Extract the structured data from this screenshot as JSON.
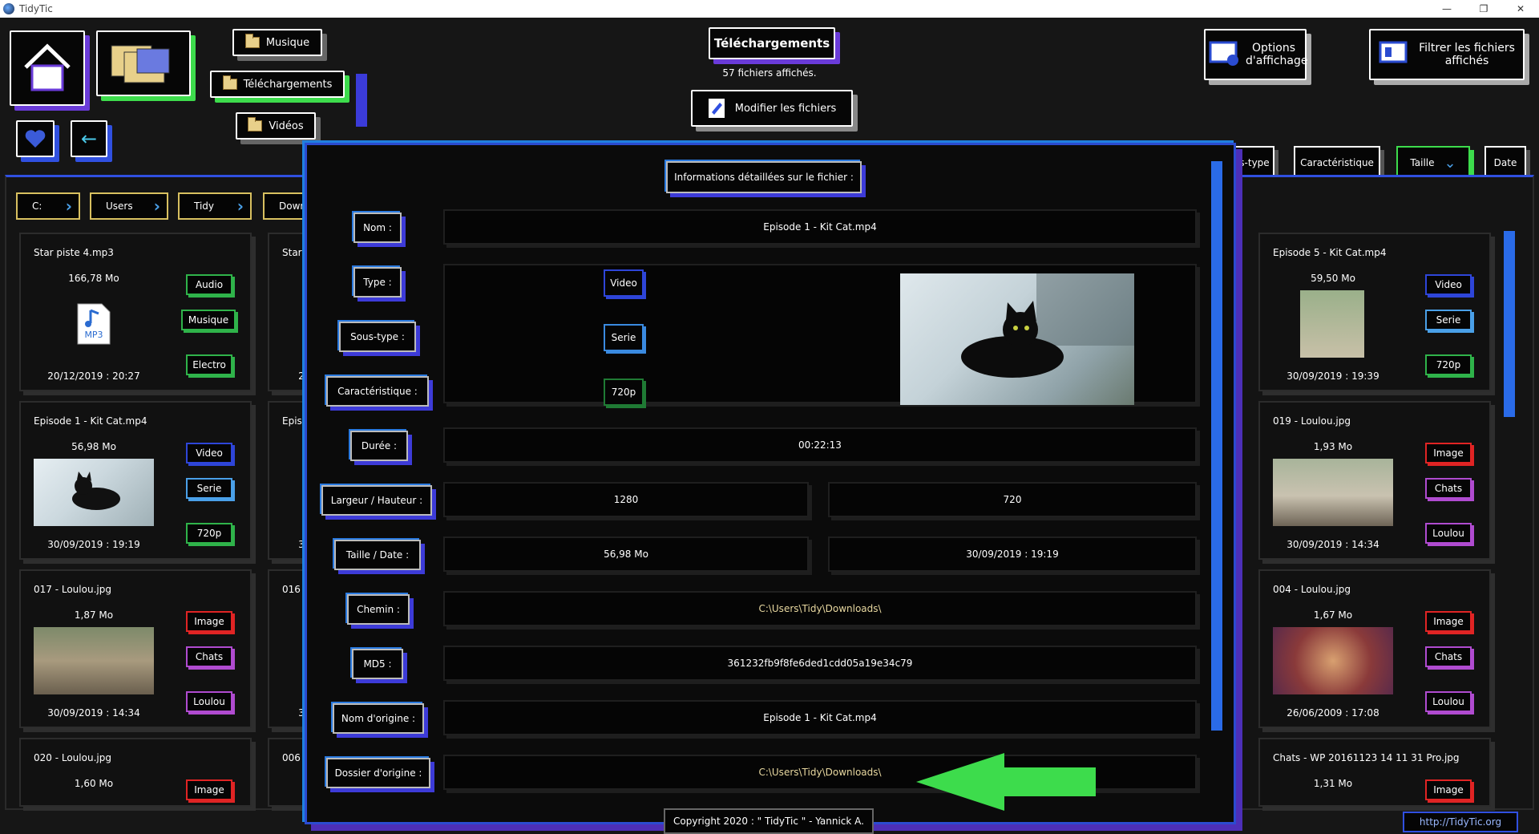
{
  "window": {
    "title": "TidyTic",
    "minimize": "—",
    "restore": "❐",
    "close": "✕"
  },
  "top": {
    "folders": [
      "Musique",
      "Téléchargements",
      "Vidéos"
    ],
    "current_folder": "Téléchargements",
    "files_count": "57 fichiers affichés.",
    "modify_btn": "Modifier les fichiers",
    "options_btn": "Options d'affichage",
    "filter_btn": "Filtrer les fichiers affichés"
  },
  "breadcrumb": [
    "C:",
    "Users",
    "Tidy",
    "Down"
  ],
  "sort": {
    "subtype": "s-type",
    "characteristic": "Caractéristique",
    "size": "Taille",
    "date": "Date"
  },
  "cards_left": [
    {
      "name": "Star piste 4.mp3",
      "size": "166,78 Mo",
      "date": "20/12/2019 : 20:27",
      "tags": [
        "Audio",
        "Musique",
        "Electro"
      ]
    },
    {
      "name": "Episode 1 - Kit Cat.mp4",
      "size": "56,98 Mo",
      "date": "30/09/2019 : 19:19",
      "tags": [
        "Video",
        "Serie",
        "720p"
      ]
    },
    {
      "name": "017 - Loulou.jpg",
      "size": "1,87 Mo",
      "date": "30/09/2019 : 14:34",
      "tags": [
        "Image",
        "Chats",
        "Loulou"
      ]
    },
    {
      "name": "020 - Loulou.jpg",
      "size": "1,60 Mo",
      "date": "",
      "tags": [
        "Image"
      ]
    }
  ],
  "cards_mid": [
    {
      "name": "Star",
      "date": "2"
    },
    {
      "name": "Episo",
      "date": "3"
    },
    {
      "name": "016",
      "date": "3"
    },
    {
      "name": "006",
      "date": ""
    }
  ],
  "cards_right": [
    {
      "name": "Episode 5 - Kit Cat.mp4",
      "size": "59,50 Mo",
      "date": "30/09/2019 : 19:39",
      "tags": [
        "Video",
        "Serie",
        "720p"
      ]
    },
    {
      "name": "019 - Loulou.jpg",
      "size": "1,93 Mo",
      "date": "30/09/2019 : 14:34",
      "tags": [
        "Image",
        "Chats",
        "Loulou"
      ]
    },
    {
      "name": "004 - Loulou.jpg",
      "size": "1,67 Mo",
      "date": "26/06/2009 : 17:08",
      "tags": [
        "Image",
        "Chats",
        "Loulou"
      ]
    },
    {
      "name": "Chats - WP  20161123  14  11  31  Pro.jpg",
      "size": "1,31 Mo",
      "date": "",
      "tags": [
        "Image"
      ]
    }
  ],
  "modal": {
    "title": "Informations détaillées sur le fichier :",
    "labels": {
      "name": "Nom :",
      "type": "Type :",
      "subtype": "Sous-type :",
      "characteristic": "Caractéristique :",
      "duration": "Durée :",
      "dimensions": "Largeur / Hauteur :",
      "size_date": "Taille / Date :",
      "path": "Chemin :",
      "md5": "MD5 :",
      "orig_name": "Nom d'origine :",
      "orig_folder": "Dossier d'origine :"
    },
    "values": {
      "name": "Episode 1 - Kit Cat.mp4",
      "type": "Video",
      "subtype": "Serie",
      "characteristic": "720p",
      "duration": "00:22:13",
      "width": "1280",
      "height": "720",
      "size": "56,98 Mo",
      "date": "30/09/2019 : 19:19",
      "path": "C:\\Users\\Tidy\\Downloads\\",
      "md5": "361232fb9f8fe6ded1cdd05a19e34c79",
      "orig_name": "Episode 1 - Kit Cat.mp4",
      "orig_folder": "C:\\Users\\Tidy\\Downloads\\"
    }
  },
  "footer": {
    "copyright": "Copyright 2020 : \" TidyTic \" - Yannick A.",
    "link": "http://TidyTic.org"
  }
}
